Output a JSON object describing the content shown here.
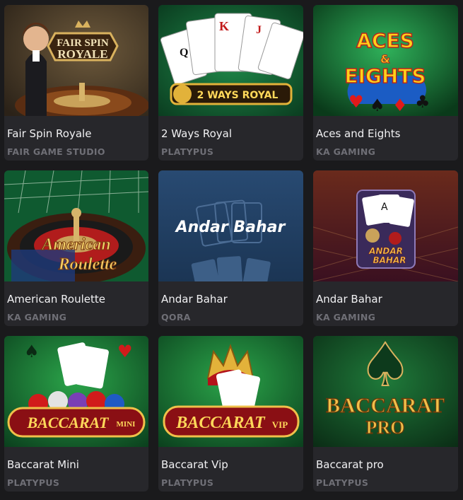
{
  "games": [
    {
      "title": "Fair Spin Royale",
      "provider": "FAIR GAME STUDIO",
      "art_text": "FAIR SPIN ROYALE"
    },
    {
      "title": "2 Ways Royal",
      "provider": "PLATYPUS",
      "art_text": "2 WAYS ROYAL"
    },
    {
      "title": "Aces and Eights",
      "provider": "KA GAMING",
      "art_text": "ACES & EIGHTS"
    },
    {
      "title": "American Roulette",
      "provider": "KA GAMING",
      "art_text": "American Roulette"
    },
    {
      "title": "Andar Bahar",
      "provider": "QORA",
      "art_text": "Andar Bahar"
    },
    {
      "title": "Andar Bahar",
      "provider": "KA GAMING",
      "art_text": "ANDAR BAHAR"
    },
    {
      "title": "Baccarat Mini",
      "provider": "PLATYPUS",
      "art_text": "BACCARAT MINI"
    },
    {
      "title": "Baccarat Vip",
      "provider": "PLATYPUS",
      "art_text": "BACCARAT VIP"
    },
    {
      "title": "Baccarat pro",
      "provider": "PLATYPUS",
      "art_text": "BACCARAT PRO"
    }
  ],
  "colors": {
    "page_bg": "#1a1a1c",
    "card_bg": "#27272b",
    "title": "#f1f1f3",
    "provider": "#6f6f76"
  }
}
